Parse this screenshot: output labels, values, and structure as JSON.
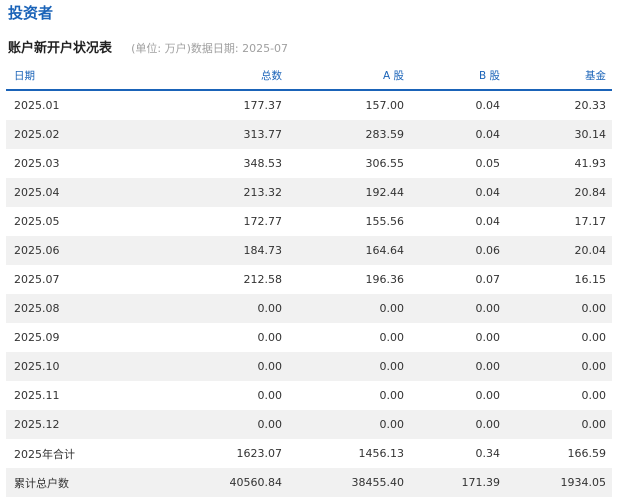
{
  "header": {
    "title": "投资者"
  },
  "section": {
    "subtitle": "账户新开户状况表",
    "meta": "(单位: 万户)数据日期:  2025-07"
  },
  "table": {
    "columns": [
      "日期",
      "总数",
      "A 股",
      "B 股",
      "基金"
    ],
    "rows": [
      [
        "2025.01",
        "177.37",
        "157.00",
        "0.04",
        "20.33"
      ],
      [
        "2025.02",
        "313.77",
        "283.59",
        "0.04",
        "30.14"
      ],
      [
        "2025.03",
        "348.53",
        "306.55",
        "0.05",
        "41.93"
      ],
      [
        "2025.04",
        "213.32",
        "192.44",
        "0.04",
        "20.84"
      ],
      [
        "2025.05",
        "172.77",
        "155.56",
        "0.04",
        "17.17"
      ],
      [
        "2025.06",
        "184.73",
        "164.64",
        "0.06",
        "20.04"
      ],
      [
        "2025.07",
        "212.58",
        "196.36",
        "0.07",
        "16.15"
      ],
      [
        "2025.08",
        "0.00",
        "0.00",
        "0.00",
        "0.00"
      ],
      [
        "2025.09",
        "0.00",
        "0.00",
        "0.00",
        "0.00"
      ],
      [
        "2025.10",
        "0.00",
        "0.00",
        "0.00",
        "0.00"
      ],
      [
        "2025.11",
        "0.00",
        "0.00",
        "0.00",
        "0.00"
      ],
      [
        "2025.12",
        "0.00",
        "0.00",
        "0.00",
        "0.00"
      ],
      [
        "2025年合计",
        "1623.07",
        "1456.13",
        "0.34",
        "166.59"
      ],
      [
        "累计总户数",
        "40560.84",
        "38455.40",
        "171.39",
        "1934.05"
      ]
    ]
  },
  "colors": {
    "accent": "#1a63b8",
    "stripe": "#f1f1f1",
    "muted": "#a0a0a0"
  }
}
